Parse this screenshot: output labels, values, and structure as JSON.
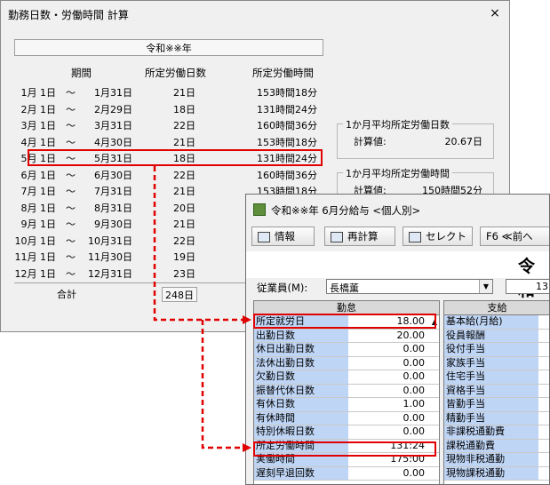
{
  "dialog": {
    "title": "勤務日数・労働時間 計算",
    "close": "×",
    "year": "令和※※年",
    "headers": {
      "period": "期間",
      "days": "所定労働日数",
      "hours": "所定労働時間"
    },
    "rows": [
      {
        "from": "1月 1日",
        "to": "1月31日",
        "days": "21日",
        "hours": "153時間18分"
      },
      {
        "from": "2月 1日",
        "to": "2月29日",
        "days": "18日",
        "hours": "131時間24分"
      },
      {
        "from": "3月 1日",
        "to": "3月31日",
        "days": "22日",
        "hours": "160時間36分"
      },
      {
        "from": "4月 1日",
        "to": "4月30日",
        "days": "21日",
        "hours": "153時間18分"
      },
      {
        "from": "5月 1日",
        "to": "5月31日",
        "days": "18日",
        "hours": "131時間24分"
      },
      {
        "from": "6月 1日",
        "to": "6月30日",
        "days": "22日",
        "hours": "160時間36分"
      },
      {
        "from": "7月 1日",
        "to": "7月31日",
        "days": "21日",
        "hours": "153時間18分"
      },
      {
        "from": "8月 1日",
        "to": "8月31日",
        "days": "20日",
        "hours": ""
      },
      {
        "from": "9月 1日",
        "to": "9月30日",
        "days": "21日",
        "hours": ""
      },
      {
        "from": "10月 1日",
        "to": "10月31日",
        "days": "22日",
        "hours": ""
      },
      {
        "from": "11月 1日",
        "to": "11月30日",
        "days": "19日",
        "hours": ""
      },
      {
        "from": "12月 1日",
        "to": "12月31日",
        "days": "23日",
        "hours": ""
      }
    ],
    "tilde": "～",
    "total_label": "合計",
    "total_days": "248日",
    "avg_days": {
      "title": "1か月平均所定労働日数",
      "label": "計算値:",
      "value": "20.67日"
    },
    "avg_hours": {
      "title": "1か月平均所定労働時間",
      "label": "計算値:",
      "value": "150時間52分"
    }
  },
  "payroll": {
    "title": "令和※※年 6月分給与 <個人別>",
    "toolbar": [
      {
        "label": "情報",
        "icon": "info-icon"
      },
      {
        "label": "再計算",
        "icon": "recalc-icon"
      },
      {
        "label": "セレクト",
        "icon": "select-icon"
      },
      {
        "label": "F6  ≪前へ",
        "icon": ""
      }
    ],
    "big_label": "令和",
    "employee_label": "従業員(M):",
    "employee_value": "長橋薫",
    "employee_code": "13",
    "attendance_head": "勤怠",
    "attendance": [
      {
        "label": "所定就労日",
        "value": "18.00"
      },
      {
        "label": "出勤日数",
        "value": "20.00"
      },
      {
        "label": "休日出勤日数",
        "value": "0.00"
      },
      {
        "label": "法休出勤日数",
        "value": "0.00"
      },
      {
        "label": "欠勤日数",
        "value": "0.00"
      },
      {
        "label": "振替代休日数",
        "value": "0.00"
      },
      {
        "label": "有休日数",
        "value": "1.00"
      },
      {
        "label": "有休時間",
        "value": "0.00"
      },
      {
        "label": "特別休暇日数",
        "value": "0.00"
      },
      {
        "label": "所定労働時間",
        "value": "131:24"
      },
      {
        "label": "実働時間",
        "value": "175:00"
      },
      {
        "label": "遅刻早退回数",
        "value": "0.00"
      }
    ],
    "pay_head": "支給",
    "pay": [
      "基本給(月給)",
      "役員報酬",
      "役付手当",
      "家族手当",
      "住宅手当",
      "資格手当",
      "皆勤手当",
      "精勤手当",
      "非課税通勤費",
      "課税通勤費",
      "現物非税通勤",
      "現物課税通勤"
    ]
  }
}
